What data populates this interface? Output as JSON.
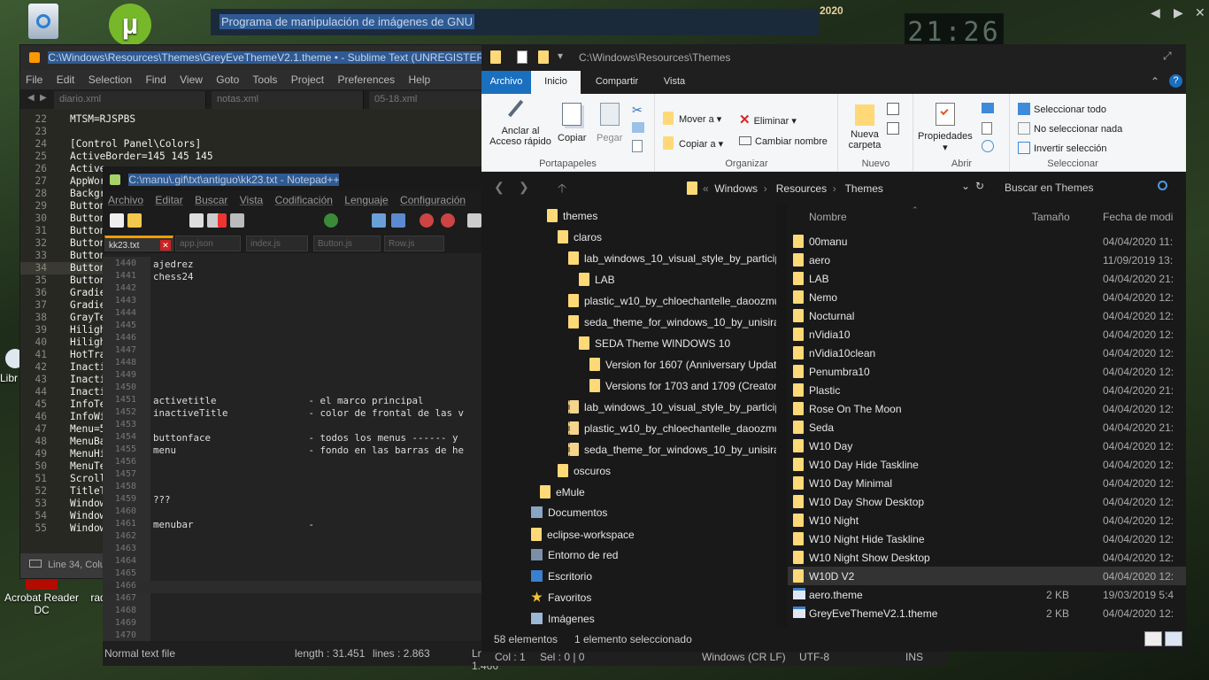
{
  "desktop": {
    "icons": [
      {
        "label": "Libr"
      },
      {
        "label": "Acrobat Reader DC"
      },
      {
        "label": "rad"
      }
    ],
    "clock": "21:26"
  },
  "gimp": {
    "title": "Programa de manipulación de imágenes de GNU",
    "badge": "2020"
  },
  "sublime": {
    "title": "C:\\Windows\\Resources\\Themes\\GreyEveThemeV2.1.theme • - Sublime Text (UNREGISTERED)",
    "menu": [
      "File",
      "Edit",
      "Selection",
      "Find",
      "View",
      "Goto",
      "Tools",
      "Project",
      "Preferences",
      "Help"
    ],
    "tabs": [
      "diario.xml",
      "notas.xml",
      "05-18.xml"
    ],
    "lines": [
      {
        "n": "22",
        "t": "MTSM=RJSPBS"
      },
      {
        "n": "23",
        "t": ""
      },
      {
        "n": "24",
        "t": "[Control Panel\\Colors]"
      },
      {
        "n": "25",
        "t": "ActiveBorder=145 145 145"
      },
      {
        "n": "26",
        "t": "Active"
      },
      {
        "n": "27",
        "t": "AppWor"
      },
      {
        "n": "28",
        "t": "Backgr"
      },
      {
        "n": "29",
        "t": "Button"
      },
      {
        "n": "30",
        "t": "Button"
      },
      {
        "n": "31",
        "t": "Button"
      },
      {
        "n": "32",
        "t": "Button"
      },
      {
        "n": "33",
        "t": "Button"
      },
      {
        "n": "34",
        "t": "Button"
      },
      {
        "n": "35",
        "t": "Button"
      },
      {
        "n": "36",
        "t": "Gradie"
      },
      {
        "n": "37",
        "t": "Gradie"
      },
      {
        "n": "38",
        "t": "GrayTe"
      },
      {
        "n": "39",
        "t": "Hiligh"
      },
      {
        "n": "40",
        "t": "Hiligh"
      },
      {
        "n": "41",
        "t": "HotTra"
      },
      {
        "n": "42",
        "t": "Inacti"
      },
      {
        "n": "43",
        "t": "Inacti"
      },
      {
        "n": "44",
        "t": "Inacti"
      },
      {
        "n": "45",
        "t": "InfoTe"
      },
      {
        "n": "46",
        "t": "InfoWi"
      },
      {
        "n": "47",
        "t": "Menu=5"
      },
      {
        "n": "48",
        "t": "MenuBa"
      },
      {
        "n": "49",
        "t": "MenuHi"
      },
      {
        "n": "50",
        "t": "MenuTe"
      },
      {
        "n": "51",
        "t": "Scroll"
      },
      {
        "n": "52",
        "t": "TitleT"
      },
      {
        "n": "53",
        "t": "Window"
      },
      {
        "n": "54",
        "t": "Window"
      },
      {
        "n": "55",
        "t": "Window"
      }
    ],
    "status": "Line 34, Colu"
  },
  "npp": {
    "title": "C:\\manu\\.gif\\txt\\antiguo\\kk23.txt - Notepad++",
    "menu": [
      "Archivo",
      "Editar",
      "Buscar",
      "Vista",
      "Codificación",
      "Lenguaje",
      "Configuración"
    ],
    "tabs": [
      "kk23.txt",
      "app.json",
      "index.js",
      "Button.js",
      "Row.js"
    ],
    "lines": [
      {
        "n": "1440",
        "t": "ajedrez"
      },
      {
        "n": "1441",
        "t": "chess24"
      },
      {
        "n": "1442",
        "t": ""
      },
      {
        "n": "1443",
        "t": ""
      },
      {
        "n": "1444",
        "t": ""
      },
      {
        "n": "1445",
        "t": ""
      },
      {
        "n": "1446",
        "t": ""
      },
      {
        "n": "1447",
        "t": ""
      },
      {
        "n": "1448",
        "t": ""
      },
      {
        "n": "1449",
        "t": ""
      },
      {
        "n": "1450",
        "t": ""
      },
      {
        "n": "1451",
        "t": "activetitle                - el marco principal"
      },
      {
        "n": "1452",
        "t": "inactiveTitle              - color de frontal de las v"
      },
      {
        "n": "1453",
        "t": ""
      },
      {
        "n": "1454",
        "t": "buttonface                 - todos los menus ------ y"
      },
      {
        "n": "1455",
        "t": "menu                       - fondo en las barras de he"
      },
      {
        "n": "1456",
        "t": ""
      },
      {
        "n": "1457",
        "t": ""
      },
      {
        "n": "1458",
        "t": ""
      },
      {
        "n": "1459",
        "t": "???"
      },
      {
        "n": "1460",
        "t": ""
      },
      {
        "n": "1461",
        "t": "menubar                    -"
      },
      {
        "n": "1462",
        "t": ""
      },
      {
        "n": "1463",
        "t": ""
      },
      {
        "n": "1464",
        "t": ""
      },
      {
        "n": "1465",
        "t": ""
      },
      {
        "n": "1466",
        "t": ""
      },
      {
        "n": "1467",
        "t": ""
      },
      {
        "n": "1468",
        "t": ""
      },
      {
        "n": "1469",
        "t": ""
      },
      {
        "n": "1470",
        "t": ""
      }
    ],
    "status": {
      "type": "Normal text file",
      "length": "length : 31.451",
      "lines": "lines : 2.863",
      "ln": "Ln : 1.466",
      "col": "Col : 1",
      "sel": "Sel : 0 | 0",
      "eol": "Windows (CR LF)",
      "enc": "UTF-8",
      "mode": "INS"
    }
  },
  "explorer": {
    "title": "C:\\Windows\\Resources\\Themes",
    "ribbon_tabs": [
      "Archivo",
      "Inicio",
      "Compartir",
      "Vista"
    ],
    "ribbon": {
      "pin": "Anclar al Acceso rápido",
      "copy": "Copiar",
      "paste": "Pegar",
      "portapapeles": "Portapapeles",
      "move": "Mover a",
      "copyto": "Copiar a",
      "delete": "Eliminar",
      "rename": "Cambiar nombre",
      "organizar": "Organizar",
      "newfolder": "Nueva carpeta",
      "nuevo": "Nuevo",
      "props": "Propiedades",
      "abrir": "Abrir",
      "selall": "Seleccionar todo",
      "selnone": "No seleccionar nada",
      "invert": "Invertir selección",
      "seleccionar": "Seleccionar"
    },
    "breadcrumb": [
      "Windows",
      "Resources",
      "Themes"
    ],
    "search_placeholder": "Buscar en Themes",
    "columns": [
      "Nombre",
      "Tamaño",
      "Fecha de modi"
    ],
    "tree": [
      {
        "label": "themes",
        "indent": 0,
        "type": "folder"
      },
      {
        "label": "claros",
        "indent": 1,
        "type": "folder"
      },
      {
        "label": "lab_windows_10_visual_style_by_participan",
        "indent": 2,
        "type": "folder"
      },
      {
        "label": "LAB",
        "indent": 3,
        "type": "folder"
      },
      {
        "label": "plastic_w10_by_chloechantelle_daoozmu",
        "indent": 2,
        "type": "folder"
      },
      {
        "label": "seda_theme_for_windows_10_by_unisira_d",
        "indent": 2,
        "type": "folder"
      },
      {
        "label": "SEDA Theme WINDOWS 10",
        "indent": 3,
        "type": "folder"
      },
      {
        "label": "Version for 1607 (Anniversary Update)",
        "indent": 4,
        "type": "folder"
      },
      {
        "label": "Versions for 1703 and 1709 (Creators & F",
        "indent": 4,
        "type": "folder"
      },
      {
        "label": "lab_windows_10_visual_style_by_participan",
        "indent": 2,
        "type": "zip"
      },
      {
        "label": "plastic_w10_by_chloechantelle_daoozmu.z",
        "indent": 2,
        "type": "zip"
      },
      {
        "label": "seda_theme_for_windows_10_by_unisira_d",
        "indent": 2,
        "type": "zip"
      },
      {
        "label": "oscuros",
        "indent": 1,
        "type": "folder"
      },
      {
        "label": "eMule",
        "indent": -1,
        "type": "folder"
      },
      {
        "label": "Documentos",
        "indent": -2,
        "type": "docs"
      },
      {
        "label": "eclipse-workspace",
        "indent": -2,
        "type": "folder"
      },
      {
        "label": "Entorno de red",
        "indent": -2,
        "type": "net"
      },
      {
        "label": "Escritorio",
        "indent": -2,
        "type": "desk"
      },
      {
        "label": "Favoritos",
        "indent": -2,
        "type": "star"
      },
      {
        "label": "Imágenes",
        "indent": -2,
        "type": "img"
      }
    ],
    "files": [
      {
        "name": "00manu",
        "size": "",
        "date": "04/04/2020 11:",
        "type": "folder"
      },
      {
        "name": "aero",
        "size": "",
        "date": "11/09/2019 13:",
        "type": "folder"
      },
      {
        "name": "LAB",
        "size": "",
        "date": "04/04/2020 21:",
        "type": "folder"
      },
      {
        "name": "Nemo",
        "size": "",
        "date": "04/04/2020 12:",
        "type": "folder"
      },
      {
        "name": "Nocturnal",
        "size": "",
        "date": "04/04/2020 12:",
        "type": "folder"
      },
      {
        "name": "nVidia10",
        "size": "",
        "date": "04/04/2020 12:",
        "type": "folder"
      },
      {
        "name": "nVidia10clean",
        "size": "",
        "date": "04/04/2020 12:",
        "type": "folder"
      },
      {
        "name": "Penumbra10",
        "size": "",
        "date": "04/04/2020 12:",
        "type": "folder"
      },
      {
        "name": "Plastic",
        "size": "",
        "date": "04/04/2020 21:",
        "type": "folder"
      },
      {
        "name": "Rose On The Moon",
        "size": "",
        "date": "04/04/2020 12:",
        "type": "folder"
      },
      {
        "name": "Seda",
        "size": "",
        "date": "04/04/2020 21:",
        "type": "folder"
      },
      {
        "name": "W10 Day",
        "size": "",
        "date": "04/04/2020 12:",
        "type": "folder"
      },
      {
        "name": "W10 Day Hide Taskline",
        "size": "",
        "date": "04/04/2020 12:",
        "type": "folder"
      },
      {
        "name": "W10 Day Minimal",
        "size": "",
        "date": "04/04/2020 12:",
        "type": "folder"
      },
      {
        "name": "W10 Day Show Desktop",
        "size": "",
        "date": "04/04/2020 12:",
        "type": "folder"
      },
      {
        "name": "W10 Night",
        "size": "",
        "date": "04/04/2020 12:",
        "type": "folder"
      },
      {
        "name": "W10 Night Hide Taskline",
        "size": "",
        "date": "04/04/2020 12:",
        "type": "folder"
      },
      {
        "name": "W10 Night Show Desktop",
        "size": "",
        "date": "04/04/2020 12:",
        "type": "folder"
      },
      {
        "name": "W10D V2",
        "size": "",
        "date": "04/04/2020 12:",
        "type": "folder"
      },
      {
        "name": "aero.theme",
        "size": "2 KB",
        "date": "19/03/2019 5:4",
        "type": "theme"
      },
      {
        "name": "GreyEveThemeV2.1.theme",
        "size": "2 KB",
        "date": "04/04/2020 12:",
        "type": "theme"
      }
    ],
    "selected_index": 18,
    "status_count": "58 elementos",
    "status_sel": "1 elemento seleccionado"
  }
}
